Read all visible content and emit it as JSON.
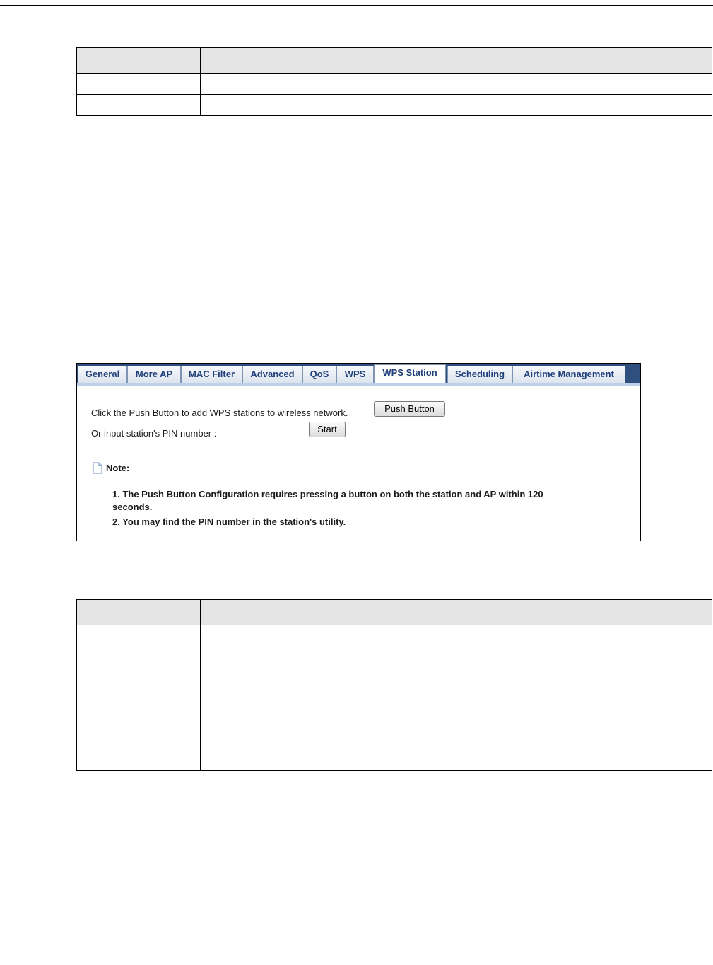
{
  "tabs": [
    {
      "label": "General"
    },
    {
      "label": "More AP"
    },
    {
      "label": "MAC Filter"
    },
    {
      "label": "Advanced"
    },
    {
      "label": "QoS"
    },
    {
      "label": "WPS"
    },
    {
      "label": "WPS Station",
      "active": true
    },
    {
      "label": "Scheduling"
    },
    {
      "label": "Airtime Management"
    }
  ],
  "wps_station": {
    "push_text": "Click the Push Button to add WPS stations to wireless network.",
    "push_button": "Push Button",
    "pin_label": "Or input station's PIN number :",
    "pin_value": "",
    "start_button": "Start",
    "note_title": "Note:",
    "note_lines": [
      "1. The Push Button Configuration requires pressing a button on both the station and AP within 120",
      "seconds.",
      "2. You may find the PIN number in the station's utility."
    ]
  },
  "colors": {
    "tab_bar": "#2f4f7f",
    "tab_text": "#1f3f7a",
    "table_header": "#e4e4e4"
  },
  "icons": {
    "note": "document-icon"
  }
}
